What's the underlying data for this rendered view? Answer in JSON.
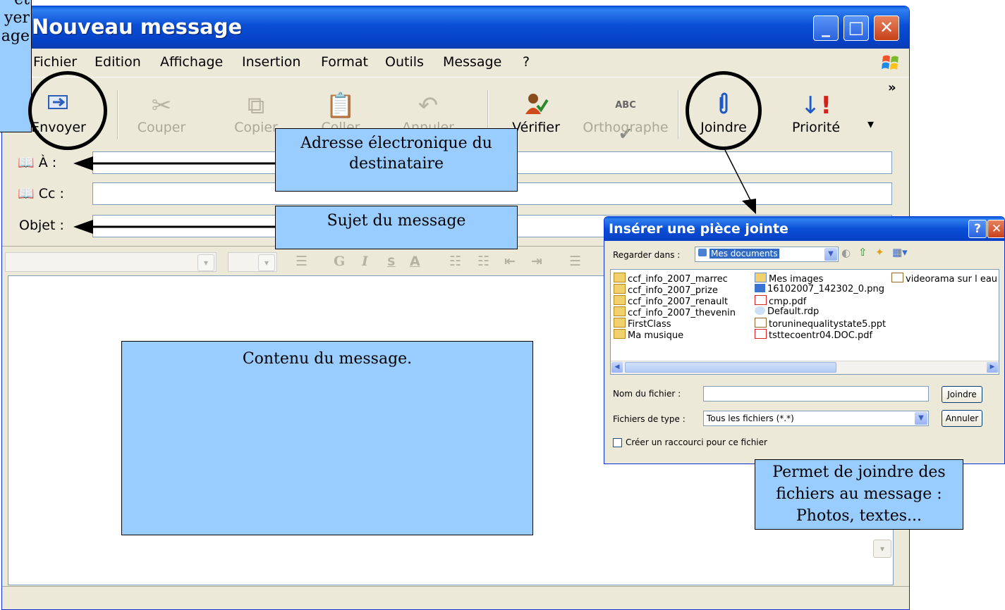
{
  "window": {
    "title": "Nouveau message",
    "menu": [
      "Fichier",
      "Edition",
      "Affichage",
      "Insertion",
      "Format",
      "Outils",
      "Message",
      "?"
    ],
    "toolbar": {
      "send": "Envoyer",
      "cut": "Couper",
      "copy": "Copier",
      "paste": "Coller",
      "undo": "Annuler",
      "check": "Vérifier",
      "spelling": "Orthographe",
      "attach": "Joindre",
      "priority": "Priorité",
      "spelling_icon_text": "ABC",
      "more": "»"
    },
    "fields": {
      "to_label": "À :",
      "cc_label": "Cc :",
      "subject_label": "Objet :"
    },
    "format": {
      "bold": "G",
      "italic": "I",
      "underline": "S",
      "color": "A"
    }
  },
  "callouts": {
    "send_partial_1": "et",
    "send_partial_2": "yer",
    "send_partial_3": "age",
    "address": "Adresse électronique du destinataire",
    "subject": "Sujet du message",
    "content": "Contenu du message.",
    "attach": "Permet de joindre des fichiers au message : Photos, textes..."
  },
  "dialog": {
    "title": "Insérer une pièce jointe",
    "look_in_label": "Regarder dans :",
    "look_in_value": "Mes documents",
    "files_col1": [
      "ccf_info_2007_marrec",
      "ccf_info_2007_prize",
      "ccf_info_2007_renault",
      "ccf_info_2007_thevenin",
      "FirstClass",
      "Ma musique"
    ],
    "files_col2": [
      "Mes images",
      "16102007_142302_0.png",
      "cmp.pdf",
      "Default.rdp",
      "toruninequalitystate5.ppt",
      "tsttecoentr04.DOC.pdf"
    ],
    "files_col3": [
      "videorama sur l eau ."
    ],
    "filename_label": "Nom du fichier :",
    "filetype_label": "Fichiers de type :",
    "filetype_value": "Tous les fichiers (*.*)",
    "attach_button": "Joindre",
    "cancel_button": "Annuler",
    "shortcut_checkbox": "Créer un raccourci pour ce fichier"
  },
  "colors": {
    "callout_bg": "#99ccff",
    "xp_blue": "#0a4fd6",
    "close_red": "#c7411a"
  }
}
